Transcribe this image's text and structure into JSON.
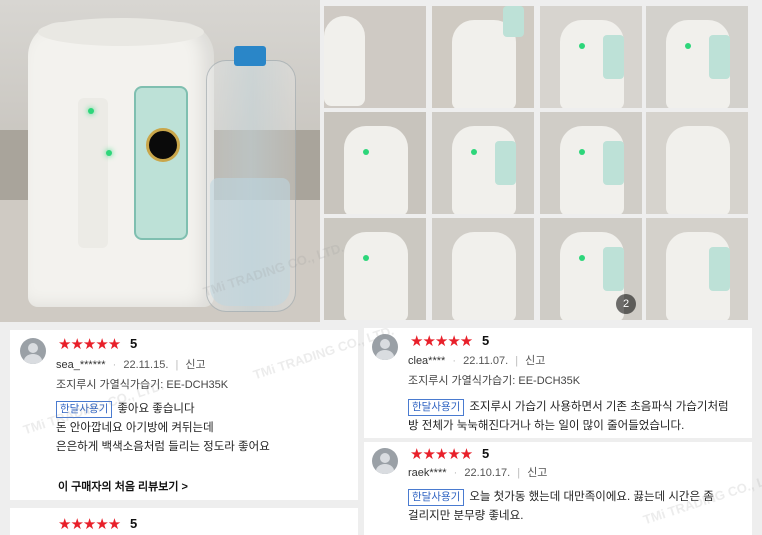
{
  "gallery": {
    "main_photo_alt": "가습기 사진",
    "thumb_count_badge": "2"
  },
  "reviews": [
    {
      "rating_stars": "★★★★★",
      "rating_score": "5",
      "user": "sea_******",
      "date": "22.11.15.",
      "report": "신고",
      "product": "조지루시 가열식가습기: EE-DCH35K",
      "tag": "한달사용기",
      "lines": [
        "좋아요 좋습니다",
        "돈 안아깝네요 아기방에 켜뒤는데",
        "은은하게 백색소음처럼 들리는 정도라 좋어요"
      ],
      "more_link": "이 구매자의 처음 리뷰보기 >"
    },
    {
      "rating_stars": "★★★★★",
      "rating_score": "5",
      "user": "clea****",
      "date": "22.11.07.",
      "report": "신고",
      "product": "조지루시 가열식가습기: EE-DCH35K",
      "tag": "한달사용기",
      "lines": [
        "조지루시 가습기 사용하면서 기존 초음파식 가습기처럼",
        "방 전체가 눅눅해진다거나 하는 일이 많이 줄어들었습니다."
      ]
    },
    {
      "rating_stars": "★★★★★",
      "rating_score": "5",
      "user": "raek****",
      "date": "22.10.17.",
      "report": "신고",
      "tag": "한달사용기",
      "lines": [
        "오늘 첫가동 했는데 대만족이에요. 끓는데 시간은 좀",
        "걸리지만 분무량 좋네요."
      ]
    },
    {
      "rating_stars": "★★★★★",
      "rating_score": "5"
    }
  ],
  "watermark_text": "TMi TRADING CO., LTD."
}
